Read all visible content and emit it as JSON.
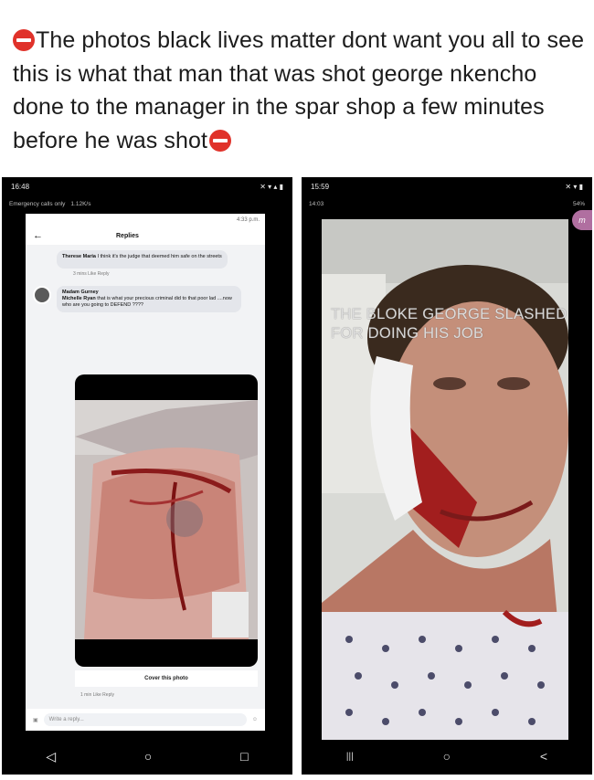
{
  "caption": "The photos black lives matter dont want you all to see this is what that man that was shot george nkencho done to the manager in the spar shop a few minutes before he was shot",
  "left": {
    "status_time": "16:48",
    "status_sub": "Emergency calls only",
    "status_sub_right": "1.12K/s",
    "inner_time_right": "4:33 p.m.",
    "header_title": "Replies",
    "comment1_name": "Therese Maria",
    "comment1_text": "I think it's the judge that deemed him safe on the streets",
    "comment1_meta": "3 mins   Like   Reply",
    "comment2_name": "Madam Gurney",
    "comment2_sub": "Michelle Ryan",
    "comment2_text": "that is what your precious criminal did to that poor lad ....now who are you going to DEFEND ????",
    "cover_label": "Cover this photo",
    "meta2": "1 min   Like   Reply",
    "reply_placeholder": "Write a reply..."
  },
  "right": {
    "status_time": "15:59",
    "status_sub_time": "14:03",
    "status_sub_right": "54%",
    "tag_letter": "m",
    "overlay_text": "THE BLOKE GEORGE SLASHED FOR DOING HIS JOB"
  },
  "nav": {
    "back": "◁",
    "home": "○",
    "recent": "□",
    "menu": "|||",
    "back2": "<"
  },
  "icons": [
    "no-entry-icon",
    "back-arrow-icon",
    "camera-icon",
    "emoji-icon",
    "share-icon"
  ]
}
